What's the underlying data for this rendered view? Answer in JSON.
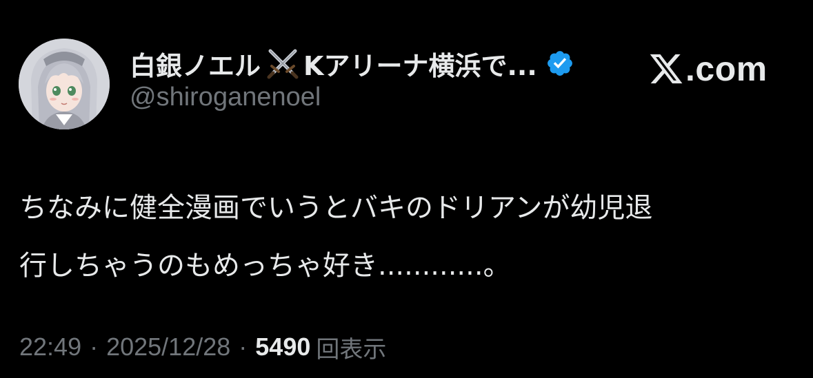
{
  "author": {
    "display_name": "白銀ノエル",
    "display_name_emoji": "crossed-swords-icon",
    "display_name_rest": "Kアリーナ横浜で...",
    "handle": "@shiroganenoel",
    "verified": true,
    "verified_color": "#1d9bf0",
    "avatar": "avatar-icon"
  },
  "brand": {
    "icon": "x-logo-icon",
    "domain": ".com"
  },
  "tweet": {
    "lines": [
      "ちなみに健全漫画でいうとバキのドリアンが幼児退",
      "行しちゃうのもめっちゃ好き............。"
    ]
  },
  "meta": {
    "time": "22:49",
    "separator": "·",
    "date": "2025/12/28",
    "views_count": "5490",
    "views_label": "回表示"
  },
  "colors": {
    "background": "#000000",
    "primary_text": "#e7e9ea",
    "secondary_text": "#71767b"
  }
}
